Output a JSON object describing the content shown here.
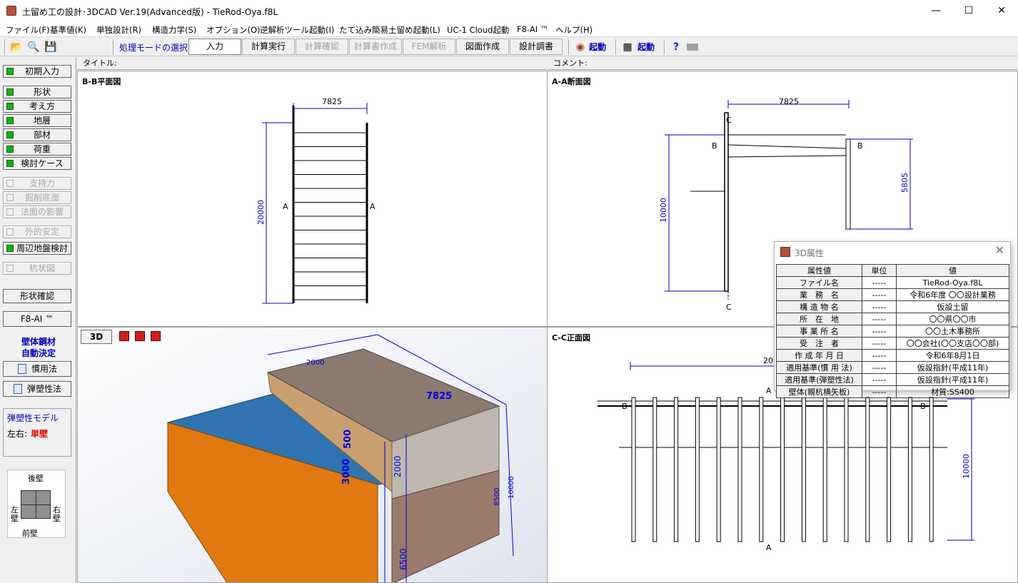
{
  "window": {
    "title": "土留め工の設計･3DCAD Ver.19(Advanced版) - TieRod-Oya.f8L",
    "minimize": "—",
    "maximize": "☐",
    "close": "✕"
  },
  "menu": [
    "ファイル(F)",
    "基準値(K)",
    "単独設計(R)",
    "構造力学(S)",
    "オプション(O)",
    "逆解析ツール起動(I)",
    "たて込み簡易土留め起動(L)",
    "UC-1 Cloud起動",
    "F8-AI ™",
    "ヘルプ(H)"
  ],
  "toolbar": {
    "mode_label": "処理モードの選択",
    "modes": [
      {
        "label": "入力",
        "state": "active"
      },
      {
        "label": "計算実行",
        "state": "enabled"
      },
      {
        "label": "計算確認",
        "state": "disabled"
      },
      {
        "label": "計算書作成",
        "state": "disabled"
      },
      {
        "label": "FEM解析",
        "state": "disabled"
      },
      {
        "label": "図面作成",
        "state": "enabled"
      },
      {
        "label": "設計調書",
        "state": "enabled"
      }
    ],
    "launch1": "起動",
    "launch2": "起動"
  },
  "sidebar": {
    "initial": "初期入力",
    "group1": [
      "形状",
      "考え方",
      "地層",
      "部材",
      "荷重",
      "検討ケース"
    ],
    "group2": [
      "支持力",
      "掘削底面",
      "法面の影響"
    ],
    "external": "外的安定",
    "surrounding": "周辺地盤検討",
    "pile_plan": "杭状図",
    "shape_check": "形状確認",
    "ai": "F8-AI ™",
    "auto_label_1": "壁体鋼材",
    "auto_label_2": "自動決定",
    "method1": "慣用法",
    "method2": "弾塑性法",
    "model_title": "弾塑性モデル",
    "model_side_label": "左右:",
    "model_side_value": "単壁",
    "dir_back": "後壁",
    "dir_front": "前壁",
    "dir_left": "左壁",
    "dir_right": "右壁"
  },
  "panes": {
    "title_label": "タイトル:",
    "comment_label": "コメント:",
    "bb_title": "B-B平面図",
    "aa_title": "A-A断面図",
    "cc_title": "C-C正面図",
    "btn_3d": "3D",
    "bb_dim_w": "7825",
    "bb_dim_h": "20000",
    "aa_dim_w": "7825",
    "aa_dim_h1": "10000",
    "aa_dim_h2": "5805",
    "cc_dim_w": "200",
    "cc_dim_h": "10000",
    "mark_a": "A",
    "mark_b": "B",
    "mark_c": "C",
    "model3d_labels": {
      "w2000": "2000",
      "d7825": "7825",
      "h3000": "3000",
      "h500": "500",
      "h10000": "10000",
      "h6500": "6500",
      "h8500": "8500",
      "h2000": "2000"
    }
  },
  "dialog": {
    "title": "3D属性",
    "headers": [
      "属性値",
      "単位",
      "値"
    ],
    "rows": [
      [
        "ファイル名",
        "-----",
        "TieRod-Oya.f8L"
      ],
      [
        "業　務　名",
        "-----",
        "令和6年度 〇〇設計業務"
      ],
      [
        "構 造 物 名",
        "-----",
        "仮設土留"
      ],
      [
        "所　在　地",
        "-----",
        "〇〇県〇〇市"
      ],
      [
        "事 業 所 名",
        "-----",
        "〇〇土木事務所"
      ],
      [
        "受　注　者",
        "-----",
        "〇〇会社(〇〇支店〇〇部)"
      ],
      [
        "作 成 年 月 日",
        "-----",
        "令和6年8月1日"
      ],
      [
        "適用基準(慣 用 法)",
        "-----",
        "仮設指針(平成11年)"
      ],
      [
        "適用基準(弾塑性法)",
        "-----",
        "仮設指針(平成11年)"
      ],
      [
        "壁体(親杭横矢板)",
        "-----",
        "材質:SS400"
      ]
    ]
  }
}
